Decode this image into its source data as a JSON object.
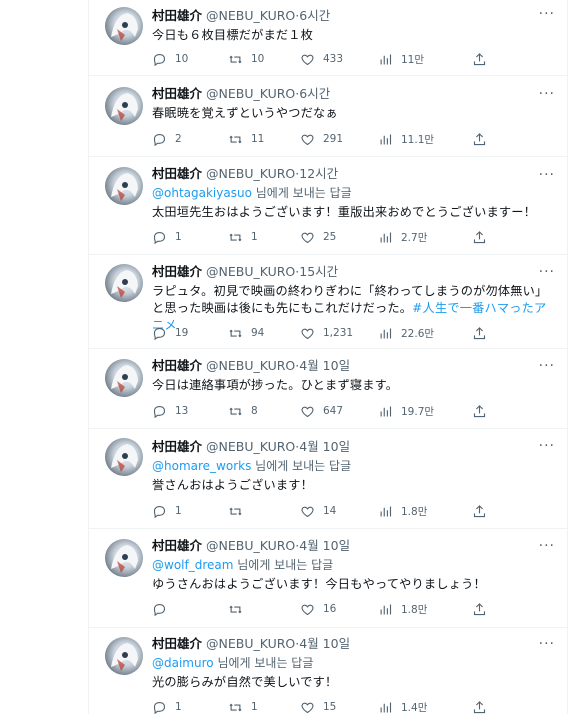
{
  "tweets": [
    {
      "name": "村田雄介",
      "handle": "@NEBU_KURO",
      "time": "6시간",
      "reply_prefix": "",
      "reply_handle": "",
      "reply_suffix": "",
      "text": "今日も６枚目標だがまだ１枚",
      "hashtag": "",
      "replies": "10",
      "retweets": "10",
      "likes": "433",
      "views": "11만"
    },
    {
      "name": "村田雄介",
      "handle": "@NEBU_KURO",
      "time": "6시간",
      "reply_prefix": "",
      "reply_handle": "",
      "reply_suffix": "",
      "text": "春眠暁を覚えずというやつだなぁ",
      "hashtag": "",
      "replies": "2",
      "retweets": "11",
      "likes": "291",
      "views": "11.1만"
    },
    {
      "name": "村田雄介",
      "handle": "@NEBU_KURO",
      "time": "12시간",
      "reply_handle": "@ohtagakiyasuo",
      "reply_suffix": " 님에게 보내는 답글",
      "text": "太田垣先生おはようございます！重版出来おめでとうございますー！",
      "hashtag": "",
      "replies": "1",
      "retweets": "1",
      "likes": "25",
      "views": "2.7만"
    },
    {
      "name": "村田雄介",
      "handle": "@NEBU_KURO",
      "time": "15시간",
      "reply_handle": "",
      "reply_suffix": "",
      "text": "ラピュタ。初見で映画の終わりぎわに「終わってしまうのが勿体無い」と思った映画は後にも先にもこれだけだった。",
      "hashtag": "#人生で一番ハマったアニメ",
      "replies": "19",
      "retweets": "94",
      "likes": "1,231",
      "views": "22.6만"
    },
    {
      "name": "村田雄介",
      "handle": "@NEBU_KURO",
      "time": "4월 10일",
      "reply_handle": "",
      "reply_suffix": "",
      "text": "今日は連絡事項が捗った。ひとまず寝ます。",
      "hashtag": "",
      "replies": "13",
      "retweets": "8",
      "likes": "647",
      "views": "19.7만"
    },
    {
      "name": "村田雄介",
      "handle": "@NEBU_KURO",
      "time": "4월 10일",
      "reply_handle": "@homare_works",
      "reply_suffix": " 님에게 보내는 답글",
      "text": "誉さんおはようございます！",
      "hashtag": "",
      "replies": "1",
      "retweets": "",
      "likes": "14",
      "views": "1.8만"
    },
    {
      "name": "村田雄介",
      "handle": "@NEBU_KURO",
      "time": "4월 10일",
      "reply_handle": "@wolf_dream",
      "reply_suffix": " 님에게 보내는 답글",
      "text": "ゆうさんおはようございます！今日もやってやりましょう！",
      "hashtag": "",
      "replies": "",
      "retweets": "",
      "likes": "16",
      "views": "1.8만"
    },
    {
      "name": "村田雄介",
      "handle": "@NEBU_KURO",
      "time": "4월 10일",
      "reply_handle": "@daimuro",
      "reply_suffix": " 님에게 보내는 답글",
      "text": "光の膨らみが自然で美しいです！",
      "hashtag": "",
      "replies": "1",
      "retweets": "1",
      "likes": "15",
      "views": "1.4만"
    }
  ]
}
